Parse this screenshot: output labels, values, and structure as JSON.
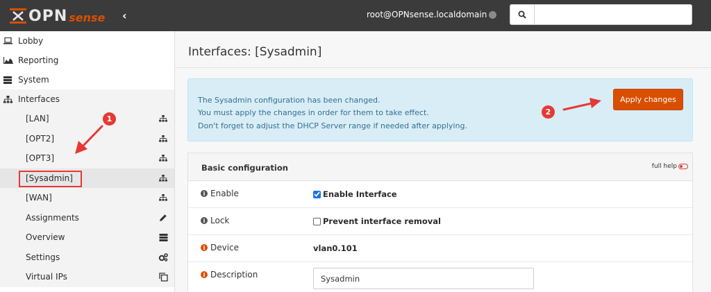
{
  "header": {
    "logo_text_main": "OPN",
    "logo_text_accent": "sense",
    "user": "root@OPNsense.localdomain",
    "collapse_glyph": "‹"
  },
  "sidebar": {
    "top_items": [
      {
        "label": "Lobby",
        "icon": "laptop-icon"
      },
      {
        "label": "Reporting",
        "icon": "area-chart-icon"
      },
      {
        "label": "System",
        "icon": "server-icon"
      },
      {
        "label": "Interfaces",
        "icon": "sitemap-icon"
      }
    ],
    "interface_items": [
      {
        "label": "[LAN]",
        "icon": "sitemap-icon"
      },
      {
        "label": "[OPT2]",
        "icon": "sitemap-icon"
      },
      {
        "label": "[OPT3]",
        "icon": "sitemap-icon"
      },
      {
        "label": "[Sysadmin]",
        "icon": "sitemap-icon"
      },
      {
        "label": "[WAN]",
        "icon": "sitemap-icon"
      },
      {
        "label": "Assignments",
        "icon": "pencil-icon"
      },
      {
        "label": "Overview",
        "icon": "list-icon"
      },
      {
        "label": "Settings",
        "icon": "cogs-icon"
      },
      {
        "label": "Virtual IPs",
        "icon": "clone-icon"
      }
    ]
  },
  "main": {
    "title": "Interfaces: [Sysadmin]",
    "alert": {
      "line1": "The Sysadmin configuration has been changed.",
      "line2": "You must apply the changes in order for them to take effect.",
      "line3": "Don't forget to adjust the DHCP Server range if needed after applying."
    },
    "apply_label": "Apply changes",
    "panel": {
      "title": "Basic configuration",
      "full_help": "full help",
      "rows": {
        "enable_label": "Enable",
        "enable_value": "Enable Interface",
        "lock_label": "Lock",
        "lock_value": "Prevent interface removal",
        "device_label": "Device",
        "device_value": "vlan0.101",
        "description_label": "Description",
        "description_value": "Sysadmin"
      }
    }
  },
  "annotations": {
    "step1": "1",
    "step2": "2"
  },
  "colors": {
    "brand": "#d94f00",
    "topbar": "#3b3b3b",
    "alert_bg": "#d9edf7",
    "annotation": "#e53935"
  }
}
